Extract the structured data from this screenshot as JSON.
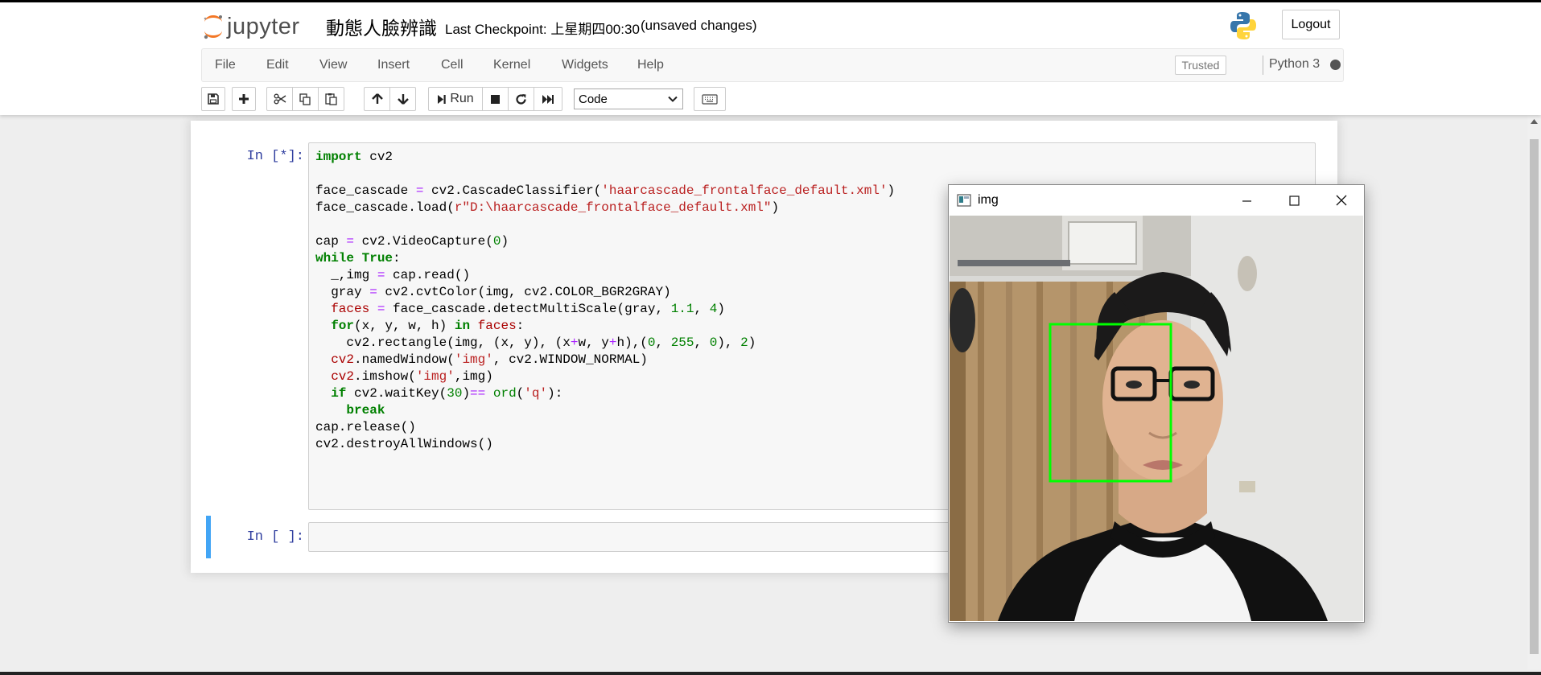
{
  "header": {
    "logo_text": "jupyter",
    "notebook_name": "動態人臉辨識",
    "checkpoint": "Last Checkpoint: 上星期四00:30",
    "autosave": "(unsaved changes)",
    "logout_label": "Logout"
  },
  "menubar": {
    "items": [
      "File",
      "Edit",
      "View",
      "Insert",
      "Cell",
      "Kernel",
      "Widgets",
      "Help"
    ],
    "trusted": "Trusted",
    "kernel": "Python 3"
  },
  "toolbar": {
    "run_label": "Run",
    "cell_type": "Code",
    "icons": [
      "save-icon",
      "plus-icon",
      "cut-icon",
      "copy-icon",
      "paste-icon",
      "arrow-up-icon",
      "arrow-down-icon",
      "run-icon",
      "stop-icon",
      "restart-icon",
      "fast-forward-icon",
      "keyboard-icon"
    ]
  },
  "cells": [
    {
      "prompt": "In [*]:",
      "code": "import cv2\n\nface_cascade = cv2.CascadeClassifier('haarcascade_frontalface_default.xml')\nface_cascade.load(r\"D:\\haarcascade_frontalface_default.xml\")\n\ncap = cv2.VideoCapture(0)\nwhile True:\n  _,img = cap.read()\n  gray = cv2.cvtColor(img, cv2.COLOR_BGR2GRAY)\n  faces = face_cascade.detectMultiScale(gray, 1.1, 4)\n  for(x, y, w, h) in faces:\n    cv2.rectangle(img, (x, y), (x+w, y+h),(0, 255, 0), 2)\n  cv2.namedWindow('img', cv2.WINDOW_NORMAL)\n  cv2.imshow('img',img)\n  if cv2.waitKey(30)== ord('q'):\n    break\ncap.release()\ncv2.destroyAllWindows()"
    },
    {
      "prompt": "In [ ]:",
      "code": ""
    }
  ],
  "image_window": {
    "title": "img",
    "face_box_color": "#00ff00"
  },
  "colors": {
    "prompt": "#303f9f",
    "selected_cell_border": "#42a5f5",
    "keyword": "#008000",
    "string": "#ba2121",
    "operator": "#aa22ff"
  }
}
